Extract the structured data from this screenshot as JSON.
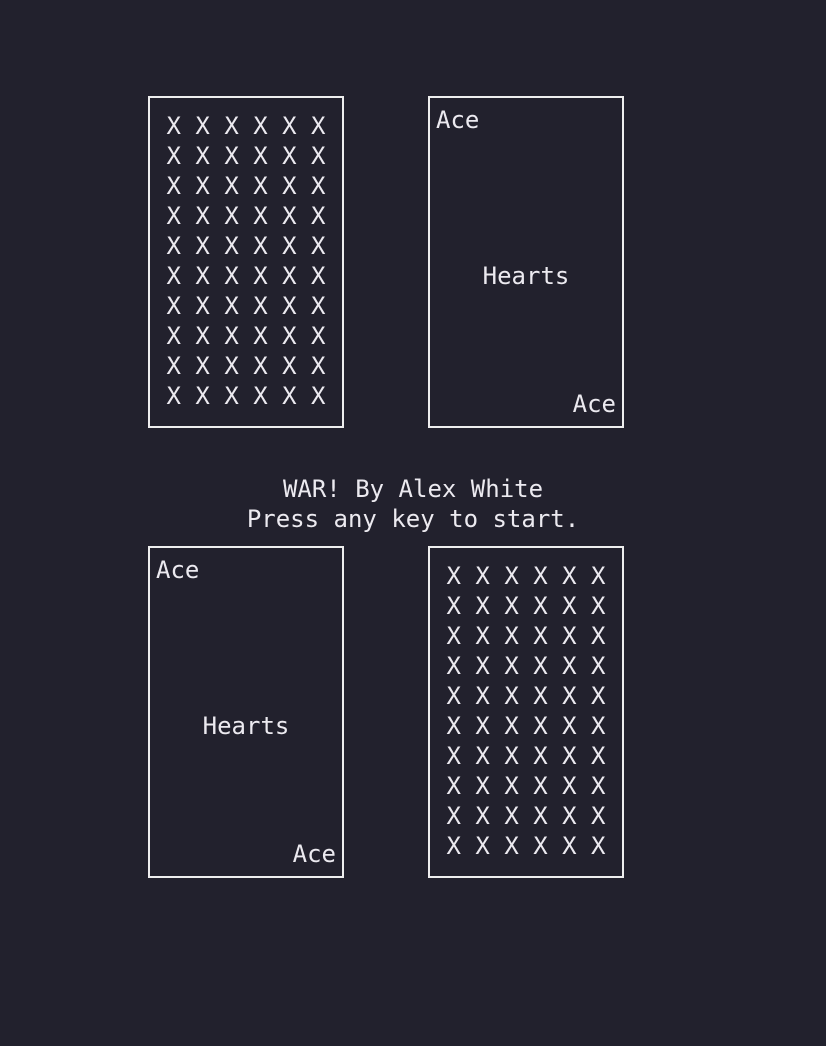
{
  "app": {
    "title": "WAR! By Alex White",
    "background_color": "#22212d",
    "foreground_color": "#eceaf0",
    "border_color": "#eeeeee"
  },
  "message": {
    "line1": "WAR! By Alex White",
    "line2": "Press any key to start."
  },
  "card_back": {
    "glyph": "X",
    "rows": 10,
    "columns": 6,
    "row_text": "X X X X X X"
  },
  "cards": {
    "top_left": {
      "position": "top-left",
      "face_up": false,
      "back_row": "X X X X X X"
    },
    "top_right": {
      "position": "top-right",
      "face_up": true,
      "rank": "Ace",
      "suit": "Hearts",
      "rank_bottom": "Ace"
    },
    "bottom_left": {
      "position": "bottom-left",
      "face_up": true,
      "rank": "Ace",
      "suit": "Hearts",
      "rank_bottom": "Ace"
    },
    "bottom_right": {
      "position": "bottom-right",
      "face_up": false,
      "back_row": "X X X X X X"
    }
  }
}
